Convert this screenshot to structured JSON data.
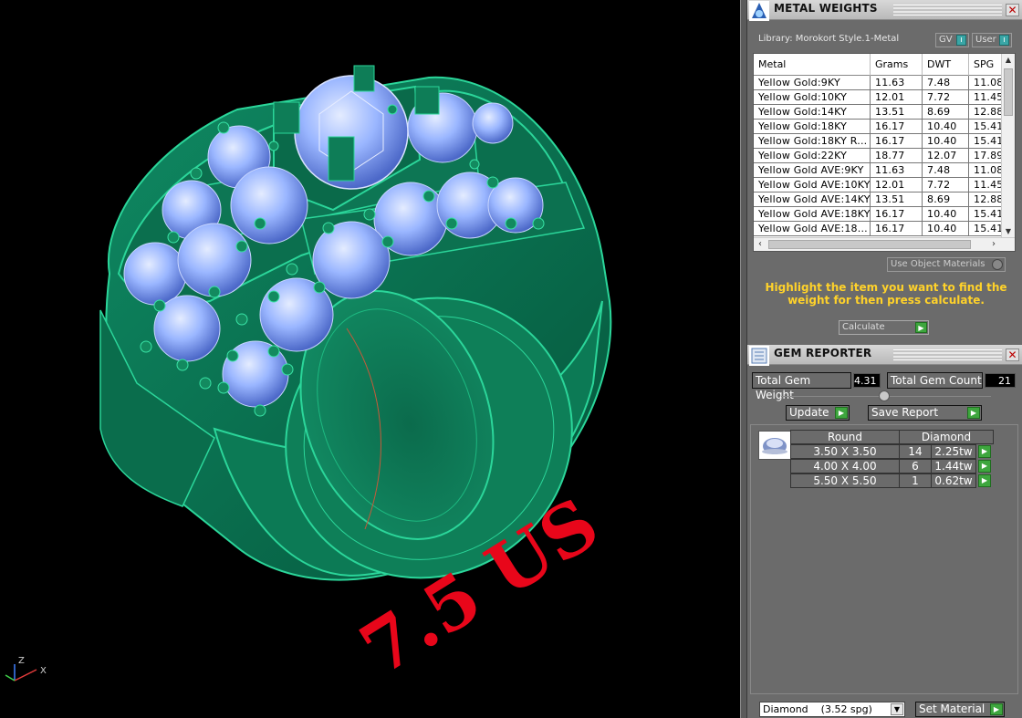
{
  "viewport": {
    "size_label": "7.5 US",
    "axes": {
      "x": "X",
      "z": "Z"
    },
    "colors": {
      "metal": "#127a58",
      "metal_edge": "#2ee0a0",
      "gem": "#8fb0ff",
      "label": "#e8061a",
      "background": "#000000"
    }
  },
  "metal_weights": {
    "title": "METAL WEIGHTS",
    "library": "Library: Morokort Style.1-Metal",
    "gv_label": "GV",
    "user_label": "User",
    "columns": [
      "Metal",
      "Grams",
      "DWT",
      "SPG"
    ],
    "rows": [
      [
        "Yellow Gold:9KY",
        "11.63",
        "7.48",
        "11.08"
      ],
      [
        "Yellow Gold:10KY",
        "12.01",
        "7.72",
        "11.45"
      ],
      [
        "Yellow Gold:14KY",
        "13.51",
        "8.69",
        "12.88"
      ],
      [
        "Yellow Gold:18KY",
        "16.17",
        "10.40",
        "15.41"
      ],
      [
        "Yellow Gold:18KY R...",
        "16.17",
        "10.40",
        "15.41"
      ],
      [
        "Yellow Gold:22KY",
        "18.77",
        "12.07",
        "17.89"
      ],
      [
        "Yellow Gold AVE:9KY",
        "11.63",
        "7.48",
        "11.08"
      ],
      [
        "Yellow Gold AVE:10KY",
        "12.01",
        "7.72",
        "11.45"
      ],
      [
        "Yellow Gold AVE:14KY",
        "13.51",
        "8.69",
        "12.88"
      ],
      [
        "Yellow Gold AVE:18KY",
        "16.17",
        "10.40",
        "15.41"
      ],
      [
        "Yellow Gold AVE:18...",
        "16.17",
        "10.40",
        "15.41"
      ]
    ],
    "use_object_materials": "Use Object Materials",
    "hint": "Highlight the item you want to find the weight for then press calculate.",
    "calculate_label": "Calculate"
  },
  "gem_reporter": {
    "title": "GEM REPORTER",
    "total_weight_label": "Total Gem Weight",
    "total_weight_value": "4.31",
    "total_count_label": "Total Gem Count",
    "total_count_value": "21",
    "update_label": "Update",
    "save_report_label": "Save Report",
    "shape_header": "Round",
    "type_header": "Diamond",
    "gems": [
      {
        "size": "3.50 X 3.50",
        "count": "14",
        "weight": "2.25tw"
      },
      {
        "size": "4.00 X 4.00",
        "count": "6",
        "weight": "1.44tw"
      },
      {
        "size": "5.50 X 5.50",
        "count": "1",
        "weight": "0.62tw"
      }
    ],
    "material_select": "Diamond    (3.52 spg)",
    "set_material_label": "Set Material"
  }
}
